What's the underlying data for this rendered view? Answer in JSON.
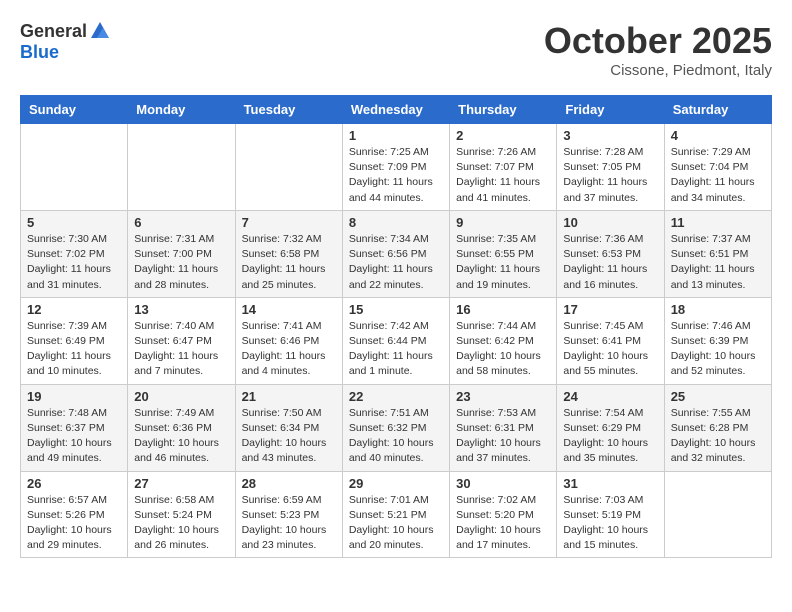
{
  "header": {
    "logo_general": "General",
    "logo_blue": "Blue",
    "month_title": "October 2025",
    "location": "Cissone, Piedmont, Italy"
  },
  "days_of_week": [
    "Sunday",
    "Monday",
    "Tuesday",
    "Wednesday",
    "Thursday",
    "Friday",
    "Saturday"
  ],
  "weeks": [
    [
      {
        "day": "",
        "info": ""
      },
      {
        "day": "",
        "info": ""
      },
      {
        "day": "",
        "info": ""
      },
      {
        "day": "1",
        "info": "Sunrise: 7:25 AM\nSunset: 7:09 PM\nDaylight: 11 hours\nand 44 minutes."
      },
      {
        "day": "2",
        "info": "Sunrise: 7:26 AM\nSunset: 7:07 PM\nDaylight: 11 hours\nand 41 minutes."
      },
      {
        "day": "3",
        "info": "Sunrise: 7:28 AM\nSunset: 7:05 PM\nDaylight: 11 hours\nand 37 minutes."
      },
      {
        "day": "4",
        "info": "Sunrise: 7:29 AM\nSunset: 7:04 PM\nDaylight: 11 hours\nand 34 minutes."
      }
    ],
    [
      {
        "day": "5",
        "info": "Sunrise: 7:30 AM\nSunset: 7:02 PM\nDaylight: 11 hours\nand 31 minutes."
      },
      {
        "day": "6",
        "info": "Sunrise: 7:31 AM\nSunset: 7:00 PM\nDaylight: 11 hours\nand 28 minutes."
      },
      {
        "day": "7",
        "info": "Sunrise: 7:32 AM\nSunset: 6:58 PM\nDaylight: 11 hours\nand 25 minutes."
      },
      {
        "day": "8",
        "info": "Sunrise: 7:34 AM\nSunset: 6:56 PM\nDaylight: 11 hours\nand 22 minutes."
      },
      {
        "day": "9",
        "info": "Sunrise: 7:35 AM\nSunset: 6:55 PM\nDaylight: 11 hours\nand 19 minutes."
      },
      {
        "day": "10",
        "info": "Sunrise: 7:36 AM\nSunset: 6:53 PM\nDaylight: 11 hours\nand 16 minutes."
      },
      {
        "day": "11",
        "info": "Sunrise: 7:37 AM\nSunset: 6:51 PM\nDaylight: 11 hours\nand 13 minutes."
      }
    ],
    [
      {
        "day": "12",
        "info": "Sunrise: 7:39 AM\nSunset: 6:49 PM\nDaylight: 11 hours\nand 10 minutes."
      },
      {
        "day": "13",
        "info": "Sunrise: 7:40 AM\nSunset: 6:47 PM\nDaylight: 11 hours\nand 7 minutes."
      },
      {
        "day": "14",
        "info": "Sunrise: 7:41 AM\nSunset: 6:46 PM\nDaylight: 11 hours\nand 4 minutes."
      },
      {
        "day": "15",
        "info": "Sunrise: 7:42 AM\nSunset: 6:44 PM\nDaylight: 11 hours\nand 1 minute."
      },
      {
        "day": "16",
        "info": "Sunrise: 7:44 AM\nSunset: 6:42 PM\nDaylight: 10 hours\nand 58 minutes."
      },
      {
        "day": "17",
        "info": "Sunrise: 7:45 AM\nSunset: 6:41 PM\nDaylight: 10 hours\nand 55 minutes."
      },
      {
        "day": "18",
        "info": "Sunrise: 7:46 AM\nSunset: 6:39 PM\nDaylight: 10 hours\nand 52 minutes."
      }
    ],
    [
      {
        "day": "19",
        "info": "Sunrise: 7:48 AM\nSunset: 6:37 PM\nDaylight: 10 hours\nand 49 minutes."
      },
      {
        "day": "20",
        "info": "Sunrise: 7:49 AM\nSunset: 6:36 PM\nDaylight: 10 hours\nand 46 minutes."
      },
      {
        "day": "21",
        "info": "Sunrise: 7:50 AM\nSunset: 6:34 PM\nDaylight: 10 hours\nand 43 minutes."
      },
      {
        "day": "22",
        "info": "Sunrise: 7:51 AM\nSunset: 6:32 PM\nDaylight: 10 hours\nand 40 minutes."
      },
      {
        "day": "23",
        "info": "Sunrise: 7:53 AM\nSunset: 6:31 PM\nDaylight: 10 hours\nand 37 minutes."
      },
      {
        "day": "24",
        "info": "Sunrise: 7:54 AM\nSunset: 6:29 PM\nDaylight: 10 hours\nand 35 minutes."
      },
      {
        "day": "25",
        "info": "Sunrise: 7:55 AM\nSunset: 6:28 PM\nDaylight: 10 hours\nand 32 minutes."
      }
    ],
    [
      {
        "day": "26",
        "info": "Sunrise: 6:57 AM\nSunset: 5:26 PM\nDaylight: 10 hours\nand 29 minutes."
      },
      {
        "day": "27",
        "info": "Sunrise: 6:58 AM\nSunset: 5:24 PM\nDaylight: 10 hours\nand 26 minutes."
      },
      {
        "day": "28",
        "info": "Sunrise: 6:59 AM\nSunset: 5:23 PM\nDaylight: 10 hours\nand 23 minutes."
      },
      {
        "day": "29",
        "info": "Sunrise: 7:01 AM\nSunset: 5:21 PM\nDaylight: 10 hours\nand 20 minutes."
      },
      {
        "day": "30",
        "info": "Sunrise: 7:02 AM\nSunset: 5:20 PM\nDaylight: 10 hours\nand 17 minutes."
      },
      {
        "day": "31",
        "info": "Sunrise: 7:03 AM\nSunset: 5:19 PM\nDaylight: 10 hours\nand 15 minutes."
      },
      {
        "day": "",
        "info": ""
      }
    ]
  ]
}
